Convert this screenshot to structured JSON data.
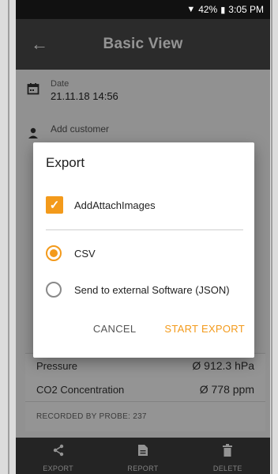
{
  "statusbar": {
    "battery": "42%",
    "time": "3:05 PM"
  },
  "appbar": {
    "title": "Basic View",
    "back_icon": "arrow-left-icon"
  },
  "list": {
    "date_label": "Date",
    "date_value": "21.11.18 14:56",
    "customer_label": "Add customer"
  },
  "card": {
    "rows": [
      {
        "label": "Pressure",
        "value": "Ø 912.3 hPa"
      },
      {
        "label": "CO2 Concentration",
        "value": "Ø 778 ppm"
      }
    ],
    "footer": "RECORDED BY PROBE:  237"
  },
  "bottombar": {
    "items": [
      {
        "label": "EXPORT",
        "icon": "share-icon"
      },
      {
        "label": "REPORT",
        "icon": "document-icon"
      },
      {
        "label": "DELETE",
        "icon": "trash-icon"
      }
    ]
  },
  "dialog": {
    "title": "Export",
    "checkbox_label": "AddAttachImages",
    "checkbox_checked": true,
    "options": [
      {
        "label": "CSV",
        "selected": true
      },
      {
        "label": "Send to external Software (JSON)",
        "selected": false
      }
    ],
    "cancel_label": "CANCEL",
    "start_label": "START EXPORT"
  },
  "colors": {
    "accent": "#f39a1b",
    "appbar": "#4a4a4a",
    "bottombar": "#3e3e3e"
  }
}
